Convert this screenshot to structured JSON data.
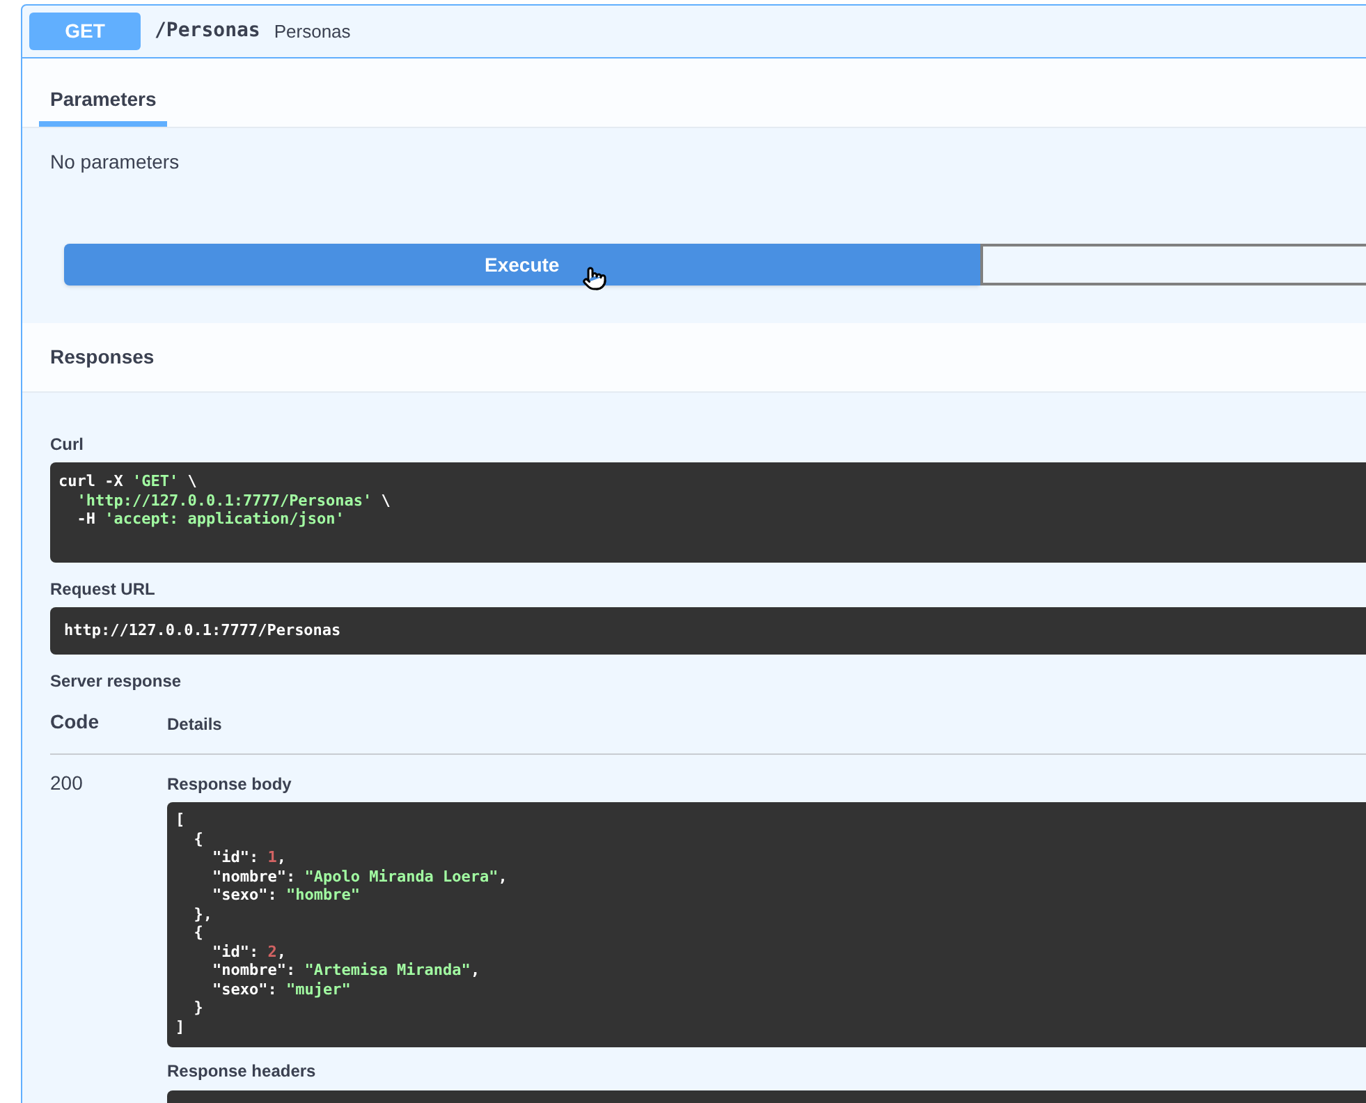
{
  "operation": {
    "method": "GET",
    "path": "/Personas",
    "summary": "Personas"
  },
  "tabs": [
    {
      "label": "Parameters",
      "selected": true
    }
  ],
  "parameters": {
    "message": "No parameters"
  },
  "buttons": {
    "execute": "Execute"
  },
  "responses": {
    "title": "Responses",
    "curl": {
      "label": "Curl",
      "lines": [
        [
          {
            "kind": "plain",
            "text": "curl -X "
          },
          {
            "kind": "string",
            "text": "'GET'"
          },
          {
            "kind": "plain",
            "text": " \\"
          }
        ],
        [
          {
            "kind": "string",
            "text": "  'http://127.0.0.1:7777/Personas'"
          },
          {
            "kind": "plain",
            "text": " \\"
          }
        ],
        [
          {
            "kind": "plain",
            "text": "  -H "
          },
          {
            "kind": "string",
            "text": "'accept: application/json'"
          }
        ]
      ]
    },
    "request_url": {
      "label": "Request URL",
      "value": "http://127.0.0.1:7777/Personas"
    },
    "server_response": {
      "label": "Server response",
      "columns": [
        "Code",
        "Details"
      ],
      "rows": [
        {
          "code": "200",
          "body_label": "Response body",
          "body_lines": [
            [
              {
                "kind": "plain",
                "text": "["
              }
            ],
            [
              {
                "kind": "plain",
                "text": "  {"
              }
            ],
            [
              {
                "kind": "plain",
                "text": "    \"id\": "
              },
              {
                "kind": "number",
                "text": "1"
              },
              {
                "kind": "plain",
                "text": ","
              }
            ],
            [
              {
                "kind": "plain",
                "text": "    \"nombre\": "
              },
              {
                "kind": "string",
                "text": "\"Apolo Miranda Loera\""
              },
              {
                "kind": "plain",
                "text": ","
              }
            ],
            [
              {
                "kind": "plain",
                "text": "    \"sexo\": "
              },
              {
                "kind": "string",
                "text": "\"hombre\""
              }
            ],
            [
              {
                "kind": "plain",
                "text": "  },"
              }
            ],
            [
              {
                "kind": "plain",
                "text": "  {"
              }
            ],
            [
              {
                "kind": "plain",
                "text": "    \"id\": "
              },
              {
                "kind": "number",
                "text": "2"
              },
              {
                "kind": "plain",
                "text": ","
              }
            ],
            [
              {
                "kind": "plain",
                "text": "    \"nombre\": "
              },
              {
                "kind": "string",
                "text": "\"Artemisa Miranda\""
              },
              {
                "kind": "plain",
                "text": ","
              }
            ],
            [
              {
                "kind": "plain",
                "text": "    \"sexo\": "
              },
              {
                "kind": "string",
                "text": "\"mujer\""
              }
            ],
            [
              {
                "kind": "plain",
                "text": "  }"
              }
            ],
            [
              {
                "kind": "plain",
                "text": "]"
              }
            ]
          ],
          "headers_label": "Response headers"
        }
      ]
    }
  }
}
